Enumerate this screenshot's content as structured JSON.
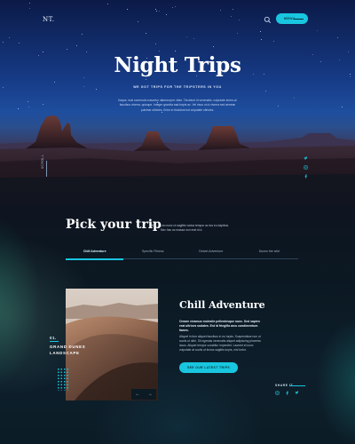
{
  "header": {
    "logo": "NT.",
    "menu_label": "MENU"
  },
  "hero": {
    "title": "Night Trips",
    "subtitle": "WE GOT TRIPS FOR THE TRIPSTERS IN YOU",
    "body": "Itaque, erat commodo nascetur ullamcorper vitae. Tincidunt id venenatis, vulputate lorem ut faucibus viverra, quisque. Integer gravida sed turpis ac. Vel risus ut ut viverra sed aenean pulvinar ultricies. Enim in tincidunt est vulputate ultricies.",
    "scroll_label": "SCROLL",
    "social_icons": [
      "twitter-icon",
      "instagram-icon",
      "facebook-icon"
    ]
  },
  "pick": {
    "title": "Pick your trip",
    "close_glyph": "×",
    "description": "Leo nunc ut sagittis varius tempor ac tus eu dapibus. Nec hac ac massa non erat id d.",
    "tabs": [
      "Chill Adventure",
      "Specific Fitness",
      "Desert Adventure",
      "Dunes the wild"
    ],
    "active_tab": 0
  },
  "card": {
    "number": "01.",
    "label": "GRAND DUNES LANDSCAPE",
    "prev_glyph": "←",
    "next_glyph": "→"
  },
  "adventure": {
    "title": "Chill Adventure",
    "lead": "Ornare vivamus molestie pellentesque nunc. Sed sapien erat ultrices sodales. Est id fringilla arcu condimentum fames.",
    "body": "Aliquet in fum aliquet faucibus in eu turpis. Suspendisse nun ut sociis ut nibh. Sit egestas venenatis aliquet adipiscing pharetra lacus. Aliquet tempor curabitur imperdiet. Laoreet et nunc vulputate at sociis ut lectus sagittis turpis, nisl tortor.",
    "cta_label": "SEE OUR LATEST TRIPS"
  },
  "share": {
    "label": "SHARE IT",
    "icons": [
      "instagram-icon",
      "facebook-icon",
      "twitter-icon"
    ]
  },
  "colors": {
    "accent": "#19c6df",
    "background": "#08171f"
  }
}
